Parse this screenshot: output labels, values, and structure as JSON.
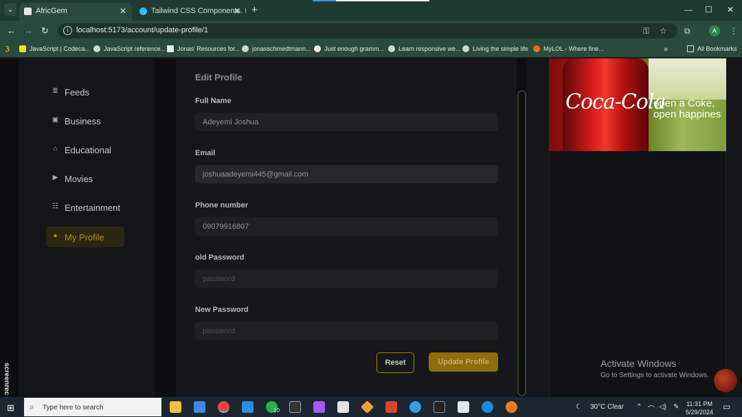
{
  "browser": {
    "tabs": [
      {
        "title": "AfricGem",
        "active": true
      },
      {
        "title": "Tailwind CSS Components. Exam",
        "active": false
      }
    ],
    "url": "localhost:5173/account/update-profile/1",
    "bookmarks": [
      "JavaScript | Codeca...",
      "JavaScript reference...",
      "Jonas' Resources for...",
      "jonasschmedtmann...",
      "Just enough gramm...",
      "Learn responsive we...",
      "Living the simple life",
      "MyLOL - Where fine...",
      "All Bookmarks"
    ],
    "avatar_letter": "A"
  },
  "sidebar": {
    "items": [
      {
        "label": "Feeds",
        "icon": "list-icon"
      },
      {
        "label": "Business",
        "icon": "briefcase-icon"
      },
      {
        "label": "Educational",
        "icon": "graduation-cap-icon"
      },
      {
        "label": "Movies",
        "icon": "play-circle-icon"
      },
      {
        "label": "Entertainment",
        "icon": "users-icon"
      },
      {
        "label": "My Profile",
        "icon": "user-icon",
        "active": true
      }
    ]
  },
  "form": {
    "title": "Edit Profile",
    "full_name": {
      "label": "Full Name",
      "value": "Adeyemi Joshua"
    },
    "email": {
      "label": "Email",
      "value": "joshuaadeyemi445@gmail.com"
    },
    "phone": {
      "label": "Phone number",
      "value": "09079916807"
    },
    "old_password": {
      "label": "old Password",
      "placeholder": "password"
    },
    "new_password": {
      "label": "New Password",
      "placeholder": "password"
    },
    "reset_label": "Reset",
    "update_label": "Update Profile"
  },
  "ad": {
    "brand": "Coca-Cola",
    "slogan_line1": "open a Coke,",
    "slogan_line2": "open happines"
  },
  "windows": {
    "activate_title": "Activate Windows",
    "activate_sub": "Go to Settings to activate Windows.",
    "watermark": "screenrec"
  },
  "taskbar": {
    "search_placeholder": "Type here to search",
    "weather": "30°C  Clear",
    "time": "11:31 PM",
    "date": "5/29/2024",
    "whatsapp_badge": "10"
  },
  "colors": {
    "accent": "#b78e10",
    "button": "#8e6d0c",
    "background": "#0d0e10"
  }
}
